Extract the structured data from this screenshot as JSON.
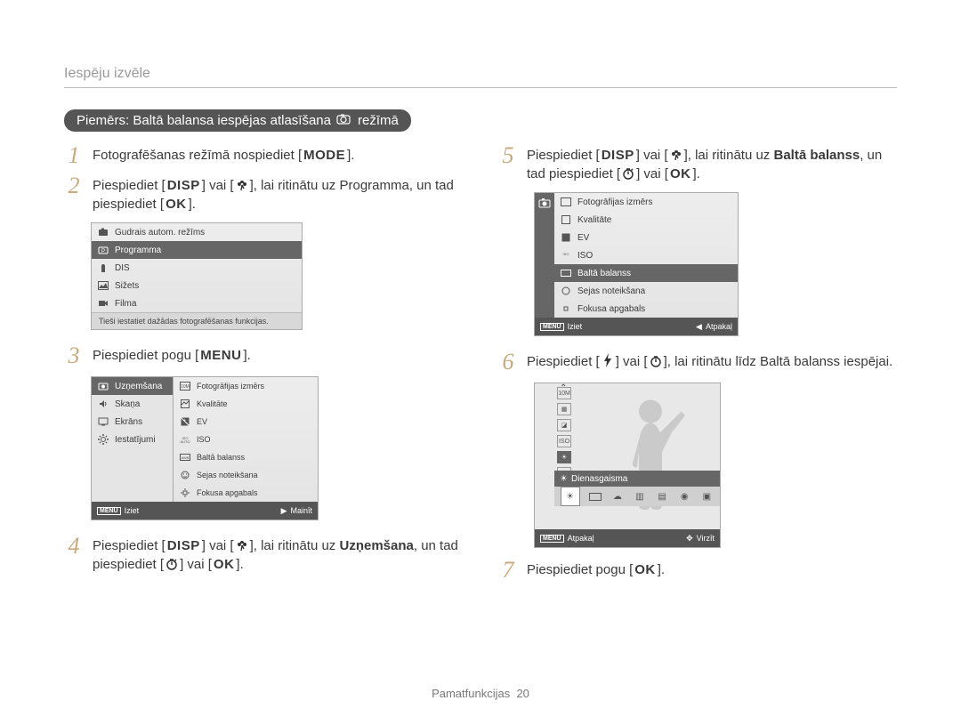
{
  "header": "Iespēju izvēle",
  "pill": {
    "prefix": "Piemērs: Baltā balansa iespējas atlasīšana ",
    "suffix": " režīmā"
  },
  "button_labels": {
    "MODE": "MODE",
    "DISP": "DISP",
    "MENU": "MENU",
    "OK": "OK"
  },
  "steps_left": {
    "1": {
      "pre": "Fotografēšanas režīmā nospiediet [",
      "btn": "MODE",
      "post": "]."
    },
    "2": {
      "text_a": "Piespiediet [",
      "btn1": "DISP",
      "text_b": "] vai [",
      "icon": "flower",
      "text_c": "], lai ritinātu uz Programma, un tad piespiediet [",
      "btn2": "OK",
      "text_d": "]."
    },
    "3": {
      "pre": "Piespiediet pogu [",
      "btn": "MENU",
      "post": "]."
    },
    "4": {
      "text_a": "Piespiediet [",
      "btn1": "DISP",
      "text_b": "] vai [",
      "icon1": "flower",
      "text_c": "], lai ritinātu uz ",
      "bold": "Uzņemšana",
      "text_d": ", un tad piespiediet [",
      "icon2": "timer",
      "text_e": "] vai [",
      "btn2": "OK",
      "text_f": "]."
    }
  },
  "steps_right": {
    "5": {
      "text_a": "Piespiediet [",
      "btn1": "DISP",
      "text_b": "] vai [",
      "icon1": "flower",
      "text_c": "], lai ritinātu uz ",
      "bold": "Baltā balanss",
      "text_d": ", un tad piespiediet [",
      "icon2": "timer",
      "text_e": "] vai [",
      "btn2": "OK",
      "text_f": "]."
    },
    "6": {
      "text_a": "Piespiediet [",
      "icon1": "flash",
      "text_b": "] vai [",
      "icon2": "timer",
      "text_c": "], lai ritinātu līdz Baltā balanss iespējai."
    },
    "7": {
      "pre": "Piespiediet pogu [",
      "btn": "OK",
      "post": "]."
    }
  },
  "lcd1": {
    "items": [
      "Gudrais autom. režīms",
      "Programma",
      "DIS",
      "Sižets",
      "Filma"
    ],
    "selected_index": 1,
    "desc": "Tieši iestatiet dažādas fotografēšanas funkcijas."
  },
  "lcd2": {
    "sidebar": [
      "Uzņemšana",
      "Skaņa",
      "Ekrāns",
      "Iestatījumi"
    ],
    "sidebar_selected": 0,
    "main": [
      "Fotogrāfijas izmērs",
      "Kvalitāte",
      "EV",
      "ISO",
      "Baltā balanss",
      "Sejas noteikšana",
      "Fokusa apgabals"
    ],
    "main_selected": -1,
    "bottom_left": "Iziet",
    "bottom_left_label": "MENU",
    "bottom_right": "Mainīt",
    "bottom_right_icon": "▶"
  },
  "lcd2b": {
    "main": [
      "Fotogrāfijas izmērs",
      "Kvalitāte",
      "EV",
      "ISO",
      "Baltā balanss",
      "Sejas noteikšana",
      "Fokusa apgabals"
    ],
    "main_selected": 4,
    "bottom_left": "Iziet",
    "bottom_left_label": "MENU",
    "bottom_right": "Atpakaļ",
    "bottom_right_icon": "◀"
  },
  "lcd3": {
    "label": "Dienasgaisma",
    "bottom_left_label": "MENU",
    "bottom_left": "Atpakaļ",
    "bottom_right": "Virzīt"
  },
  "footer": {
    "label": "Pamatfunkcijas",
    "page": "20"
  }
}
